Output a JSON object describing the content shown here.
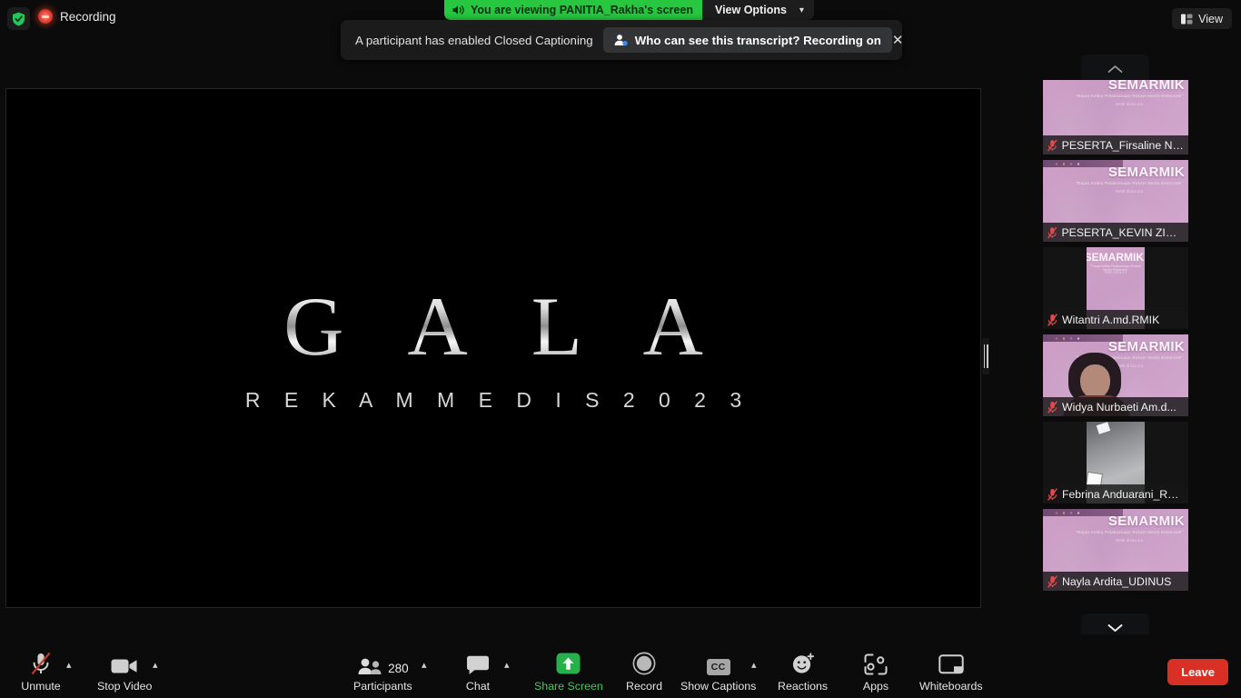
{
  "topbar": {
    "shield_icon": "shield-check-icon",
    "recording_label": "Recording",
    "view_button_label": "View",
    "view_icon": "layout-grid-icon",
    "share_banner": {
      "speaker_icon": "speaker-icon",
      "text": "You are viewing PANITIA_Rakha's screen",
      "view_options_label": "View Options",
      "chevron_icon": "chevron-down-icon",
      "accent_color": "#27c840"
    }
  },
  "notification": {
    "message": "A participant has enabled Closed Captioning",
    "pill_icon": "person-badge-icon",
    "pill_text": "Who can see this transcript? Recording on",
    "close_icon": "close-icon"
  },
  "shared_screen": {
    "window_controls": {
      "minimize": "–",
      "maximize": "❐",
      "close": "×"
    },
    "slide": {
      "title": "G A L A",
      "subtitle": "R E K A M  M E D I S  2 0 2 3"
    },
    "divider_icon": "drag-handle-icon"
  },
  "filmstrip": {
    "scroll_up_icon": "chevron-up-icon",
    "scroll_down_icon": "chevron-down-icon",
    "virtual_background": {
      "title": "SEMARMIK",
      "subtitle_1": "\"Rapat Ketika Pelaksanaan Rekam Medis Elektronik\"",
      "subtitle_2": "RMIK di Era 4.0",
      "bg_color": "#cf9ec6"
    },
    "tiles": [
      {
        "name": "PESERTA_Firsaline Na...",
        "mic_icon": "mic-muted-icon",
        "kind": "semar"
      },
      {
        "name": "PESERTA_KEVIN ZINE...",
        "mic_icon": "mic-muted-icon",
        "kind": "semar"
      },
      {
        "name": "Witantri A.md.RMIK",
        "mic_icon": "mic-muted-icon",
        "kind": "narrow"
      },
      {
        "name": "Widya Nurbaeti Am.d...",
        "mic_icon": "mic-muted-icon",
        "kind": "person"
      },
      {
        "name": "Febrina Anduarani_RS...",
        "mic_icon": "mic-muted-icon",
        "kind": "cam"
      },
      {
        "name": "Nayla Ardita_UDINUS",
        "mic_icon": "mic-muted-icon",
        "kind": "semar"
      }
    ]
  },
  "toolbar": {
    "unmute": {
      "label": "Unmute",
      "icon": "mic-muted-icon",
      "caret": "chevron-up-icon"
    },
    "stop_video": {
      "label": "Stop Video",
      "icon": "video-camera-icon",
      "caret": "chevron-up-icon"
    },
    "participants": {
      "label": "Participants",
      "icon": "people-icon",
      "count": "280",
      "caret": "chevron-up-icon"
    },
    "chat": {
      "label": "Chat",
      "icon": "chat-bubble-icon",
      "caret": "chevron-up-icon"
    },
    "share_screen": {
      "label": "Share Screen",
      "icon": "share-arrow-up-icon",
      "active_color": "#3fc75c"
    },
    "record": {
      "label": "Record",
      "icon": "record-circle-icon"
    },
    "show_captions": {
      "label": "Show Captions",
      "icon": "cc-icon",
      "badge": "CC",
      "caret": "chevron-up-icon"
    },
    "reactions": {
      "label": "Reactions",
      "icon": "smiley-plus-icon"
    },
    "apps": {
      "label": "Apps",
      "icon": "apps-icon"
    },
    "whiteboards": {
      "label": "Whiteboards",
      "icon": "whiteboard-icon"
    },
    "leave": {
      "label": "Leave",
      "color": "#d93025"
    }
  }
}
